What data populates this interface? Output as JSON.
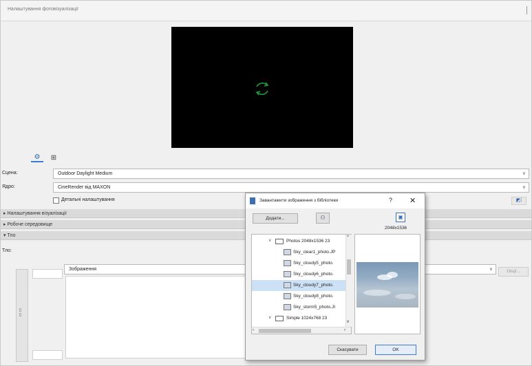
{
  "window": {
    "title": "Налаштування фотовізуалізації"
  },
  "tabs": {
    "settings_icon": "gear-icon",
    "grid_icon": "grid-icon"
  },
  "scene": {
    "label": "Сцена:",
    "value": "Outdoor Daylight Medium"
  },
  "engine": {
    "label": "Ядро:",
    "value": "CineRender від MAXON"
  },
  "detailed_settings": {
    "label": "Детальні налаштування",
    "checked": false
  },
  "sections": [
    {
      "label": "Налаштування візуалізації",
      "expanded": false
    },
    {
      "label": "Робоче середовище",
      "expanded": false
    },
    {
      "label": "Тло",
      "expanded": true
    }
  ],
  "background": {
    "label": "Тло:",
    "value": "Зображення",
    "options_button": "Опції..."
  },
  "dialog": {
    "title": "Завантажити зображення з бібліотеки",
    "help": "?",
    "close": "✕",
    "add_button": "Додати...",
    "resolution": "2048x1536",
    "tree": [
      {
        "label": "Photos 2048x1536 23",
        "type": "folder",
        "expanded": true,
        "selected": false
      },
      {
        "label": "Sky_clear1_photo.JP",
        "type": "image",
        "selected": false
      },
      {
        "label": "Sky_cloudy5_photo.",
        "type": "image",
        "selected": false
      },
      {
        "label": "Sky_cloudy6_photo.",
        "type": "image",
        "selected": false
      },
      {
        "label": "Sky_cloudy7_photo.",
        "type": "image",
        "selected": true
      },
      {
        "label": "Sky_cloudy8_photo.",
        "type": "image",
        "selected": false
      },
      {
        "label": "Sky_storm5_photo.JI",
        "type": "image",
        "selected": false
      },
      {
        "label": "Simple 1024x768 23",
        "type": "folder",
        "expanded": true,
        "selected": false
      }
    ],
    "cancel_button": "Скасувати",
    "ok_button": "OK"
  }
}
